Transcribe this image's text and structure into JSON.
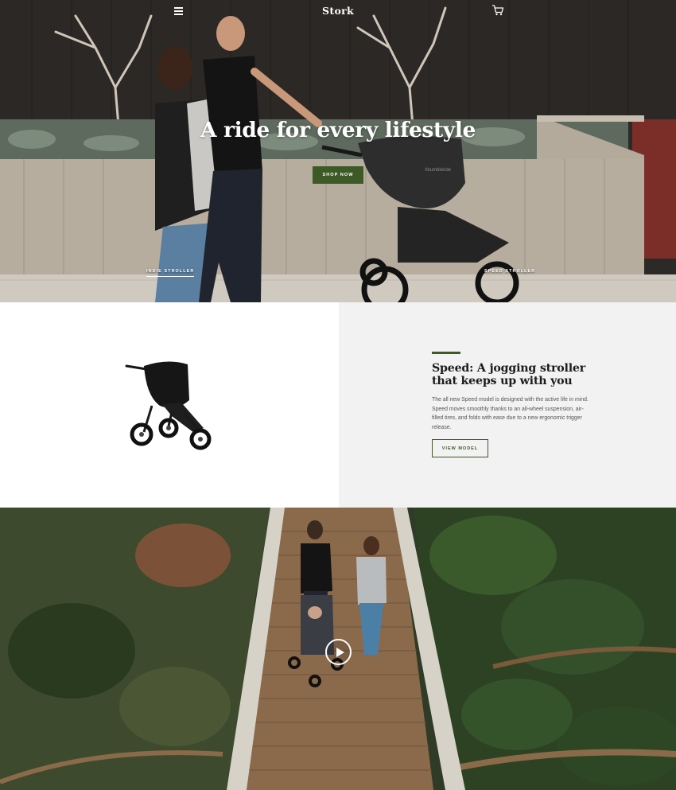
{
  "header": {
    "brand": "Stork",
    "menu_icon": "hamburger-menu-icon",
    "cart_icon": "shopping-cart-icon"
  },
  "hero": {
    "title": "A ride for every lifestyle",
    "cta_label": "SHOP NOW",
    "labels": {
      "indie": "INDIE STROLLER",
      "speed": "SPEED STROLLER"
    },
    "stroller_badge": "#bumbleride"
  },
  "feature": {
    "title": "Speed: A jogging stroller that keeps up with you",
    "body": "The all new Speed model is designed with the active life in mind. Speed moves smoothly thanks to an all-wheel suspension, air-filled tires, and folds with ease due to a new ergonomic trigger release.",
    "cta_label": "VIEW MODEL"
  },
  "video": {
    "play_icon": "play-icon"
  },
  "colors": {
    "accent": "#3d5a26",
    "feature_panel_bg": "#f1f2f1",
    "text_dark": "#1c1c1c",
    "text_muted": "#555555"
  }
}
